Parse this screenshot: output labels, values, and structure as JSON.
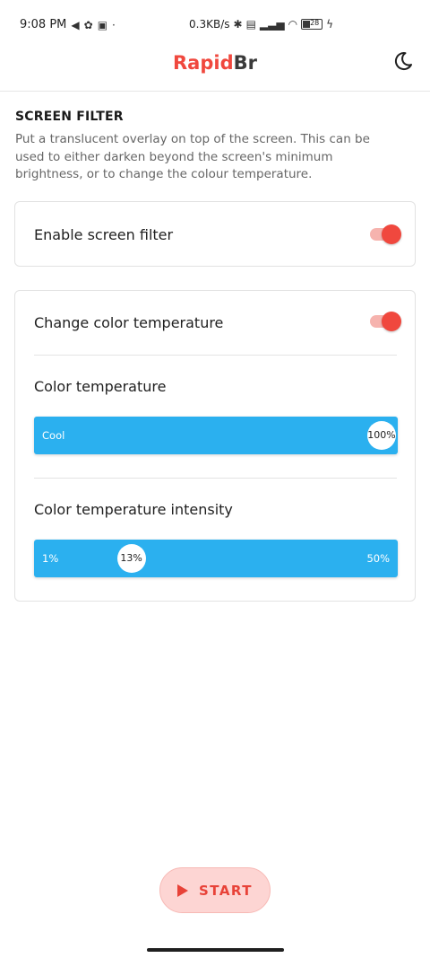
{
  "status_bar": {
    "time": "9:08 PM",
    "left_icons": [
      "telegram-icon",
      "pinwheel-icon",
      "sim-icon"
    ],
    "network_speed": "0.3KB/s",
    "battery_level": "28"
  },
  "app_bar": {
    "title_part1": "Rapid",
    "title_part2": "Br",
    "theme_icon": "moon-icon"
  },
  "section": {
    "title": "SCREEN FILTER",
    "description": "Put a translucent overlay on top of the screen. This can be used to either darken beyond the screen's minimum brightness, or to change the colour temperature."
  },
  "enable_filter": {
    "label": "Enable screen filter",
    "checked": true
  },
  "change_temp": {
    "label": "Change color temperature",
    "checked": true
  },
  "color_temperature": {
    "label": "Color temperature",
    "min_label": "Cool",
    "value_label": "100%",
    "value": 1.0
  },
  "intensity": {
    "label": "Color temperature intensity",
    "min_label": "1%",
    "max_label": "50%",
    "value_label": "13%",
    "value": 0.245
  },
  "start_button": {
    "label": "START"
  },
  "colors": {
    "accent": "#f0483e",
    "slider": "#2bb0ef",
    "start_bg": "#fdd5d3"
  }
}
